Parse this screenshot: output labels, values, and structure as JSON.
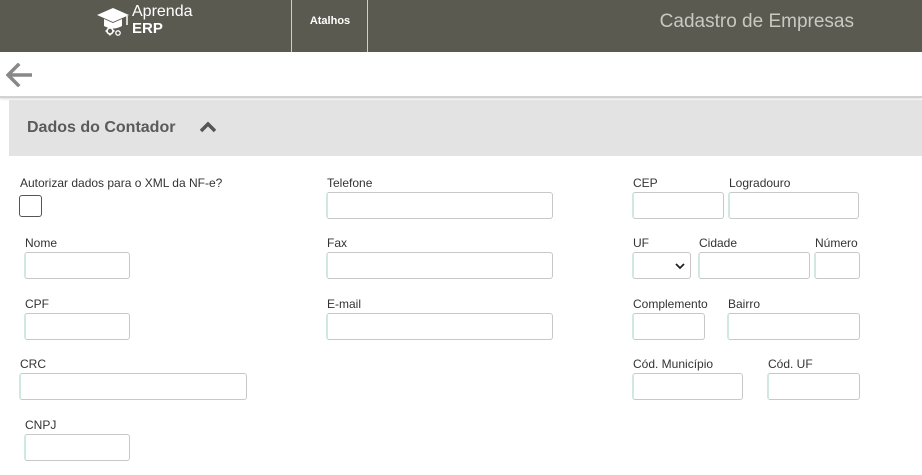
{
  "header": {
    "logo_line1": "Aprenda",
    "logo_line2": "ERP",
    "shortcuts_label": "Atalhos",
    "page_title": "Cadastro de Empresas"
  },
  "section": {
    "title": "Dados do Contador"
  },
  "form": {
    "authorize_label": "Autorizar dados para o XML da NF-e?",
    "nome_label": "Nome",
    "cpf_label": "CPF",
    "crc_label": "CRC",
    "cnpj_label": "CNPJ",
    "telefone_label": "Telefone",
    "fax_label": "Fax",
    "email_label": "E-mail",
    "cep_label": "CEP",
    "logradouro_label": "Logradouro",
    "uf_label": "UF",
    "cidade_label": "Cidade",
    "numero_label": "Número",
    "complemento_label": "Complemento",
    "bairro_label": "Bairro",
    "cod_municipio_label": "Cód. Município",
    "cod_uf_label": "Cód. UF"
  },
  "icons": {
    "logo": "graduation-cap-icon",
    "back": "arrow-left-icon",
    "collapse": "chevron-up-icon",
    "select": "chevron-down-icon"
  },
  "colors": {
    "topbar": "#5b5a51",
    "section_bg": "#e3e3e3",
    "input_accent": "#cfe8e0"
  }
}
